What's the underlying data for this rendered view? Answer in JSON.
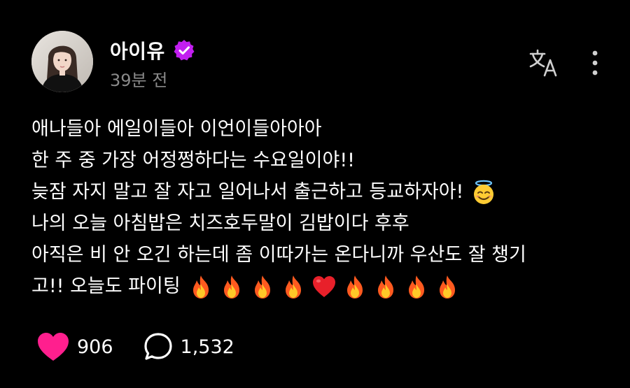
{
  "header": {
    "username": "아이유",
    "timestamp": "39분 전"
  },
  "icons": {
    "verified": "verified-badge-icon",
    "translate": "translate-icon",
    "more": "more-vertical-icon",
    "like": "heart-icon",
    "comment": "comment-bubble-icon"
  },
  "colors": {
    "verified_badge": "#c21ef0",
    "like_heart": "#ff1f8e",
    "timestamp_gray": "#8a8a8a"
  },
  "post": {
    "lines": [
      "애나들아 에일이들아 이언이들아아아",
      "한 주 중 가장 어정쩡하다는 수요일이야!!",
      "늦잠 자지 말고 잘 자고 일어나서 출근하고 등교하자아!",
      "나의 오늘 아침밥은 치즈호두말이 김밥이다 후후",
      "아직은 비 안 오긴 하는데 좀 이따가는 온다니까 우산도 잘 챙기",
      "고!! 오늘도 파이팅"
    ],
    "emoji_line3": "angel-smile-emoji",
    "emoji_line6": [
      "fire",
      "fire",
      "fire",
      "fire",
      "red-heart",
      "fire",
      "fire",
      "fire",
      "fire"
    ]
  },
  "footer": {
    "likes": "906",
    "comments": "1,532"
  }
}
